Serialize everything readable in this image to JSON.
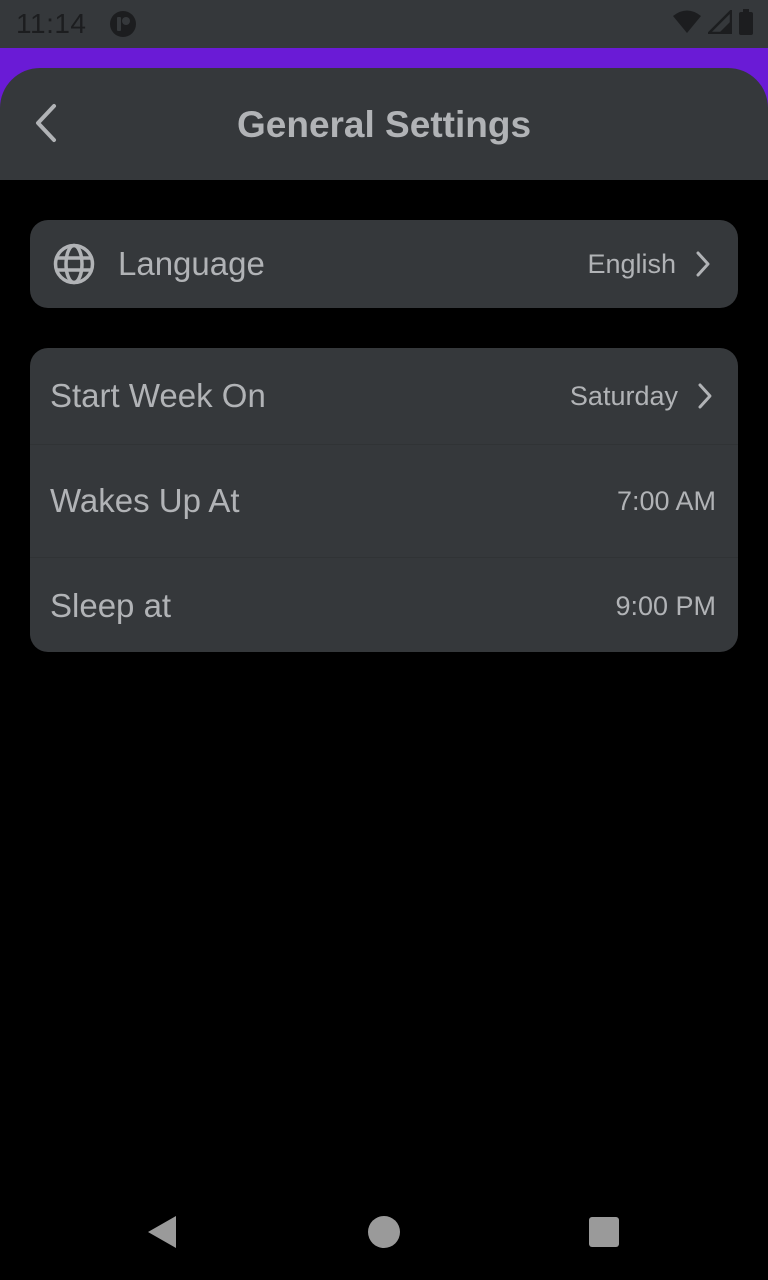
{
  "status_bar": {
    "time": "11:14",
    "app_icon": "app-badge-icon",
    "icons": [
      "wifi-icon",
      "signal-icon",
      "battery-icon"
    ]
  },
  "colors": {
    "accent": "#6a1bd6",
    "surface": "#35383b",
    "background": "#000000",
    "text": "#b1b3b6"
  },
  "header": {
    "back_icon": "chevron-left-icon",
    "title": "General Settings"
  },
  "language_card": {
    "icon": "globe-icon",
    "label": "Language",
    "value": "English",
    "chevron": "chevron-right-icon"
  },
  "schedule_card": {
    "rows": [
      {
        "label": "Start Week On",
        "value": "Saturday",
        "chevron": "chevron-right-icon"
      },
      {
        "label": "Wakes Up At",
        "value": "7:00 AM"
      },
      {
        "label": "Sleep at",
        "value": "9:00 PM"
      }
    ]
  },
  "nav_bar": {
    "icons": [
      "nav-back-icon",
      "nav-home-icon",
      "nav-recents-icon"
    ]
  }
}
